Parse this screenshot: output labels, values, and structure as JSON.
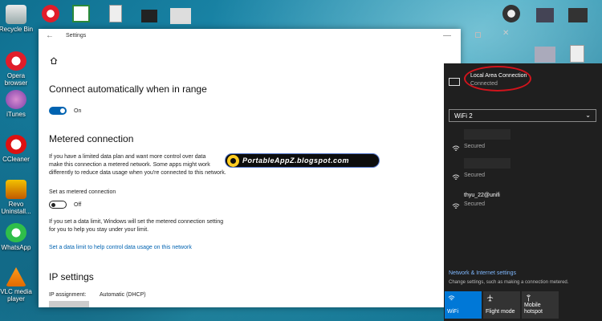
{
  "desktop": {
    "icons": [
      {
        "label": "Recycle Bin"
      },
      {
        "label": "Opera browser"
      },
      {
        "label": "iTunes"
      },
      {
        "label": "CCleaner"
      },
      {
        "label": "Revo Uninstall..."
      },
      {
        "label": "WhatsApp"
      },
      {
        "label": "VLC media player"
      }
    ]
  },
  "settings": {
    "title": "Settings",
    "connect_heading": "Connect automatically when in range",
    "connect_toggle": "On",
    "metered_heading": "Metered connection",
    "metered_desc_1": "If you have a limited data plan and want more control over data",
    "metered_desc_2": "make this connection a metered network. Some apps might work",
    "metered_desc_3": "differently to reduce data usage when you're connected to this network.",
    "set_metered_label": "Set as metered connection",
    "metered_toggle": "Off",
    "limit_desc_1": "If you set a data limit, Windows will set the metered connection setting",
    "limit_desc_2": "for you to help you stay under your limit.",
    "data_limit_link": "Set a data limit to help control data usage on this network",
    "ip_heading": "IP settings",
    "ip_assignment_label": "IP assignment:",
    "ip_assignment_value": "Automatic (DHCP)"
  },
  "watermark": "PortableAppZ.blogspot.com",
  "flyout": {
    "lan_name": "Local Area Connection",
    "lan_status": "Connected",
    "adapter": "WiFi 2",
    "networks": [
      {
        "name": "",
        "status": "Secured"
      },
      {
        "name": "",
        "status": "Secured"
      },
      {
        "name": "thyu_22@unifi",
        "status": "Secured"
      }
    ],
    "net_settings_link": "Network & Internet settings",
    "net_settings_desc": "Change settings, such as making a connection metered.",
    "quick_actions": [
      {
        "label": "WiFi"
      },
      {
        "label": "Flight mode"
      },
      {
        "label": "Mobile hotspot"
      }
    ],
    "accent": "#0078d7"
  }
}
